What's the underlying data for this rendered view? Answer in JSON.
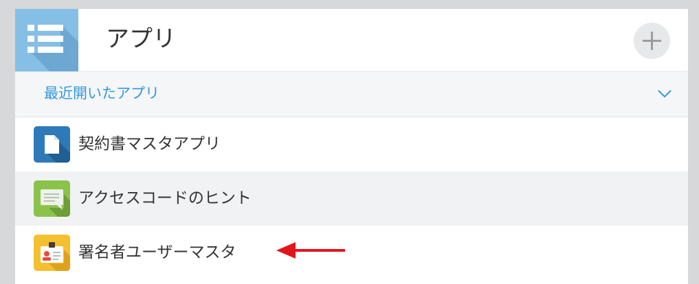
{
  "header": {
    "title": "アプリ",
    "icon": "app-list-icon",
    "add_icon": "plus-icon"
  },
  "recent": {
    "label": "最近開いたアプリ",
    "toggle_icon": "chevron-down-icon"
  },
  "apps": [
    {
      "label": "契約書マスタアプリ",
      "icon": "document-icon",
      "color": "#2e7ab8"
    },
    {
      "label": "アクセスコードのヒント",
      "icon": "chat-bubble-icon",
      "color": "#8bc34a"
    },
    {
      "label": "署名者ユーザーマスタ",
      "icon": "id-badge-icon",
      "color": "#f4c030"
    }
  ],
  "annotation": {
    "icon": "red-arrow-icon",
    "color": "#e3151c"
  },
  "colors": {
    "accent": "#3498db",
    "header_icon_bg": "#86bfe5",
    "background": "#d6d8d9"
  }
}
